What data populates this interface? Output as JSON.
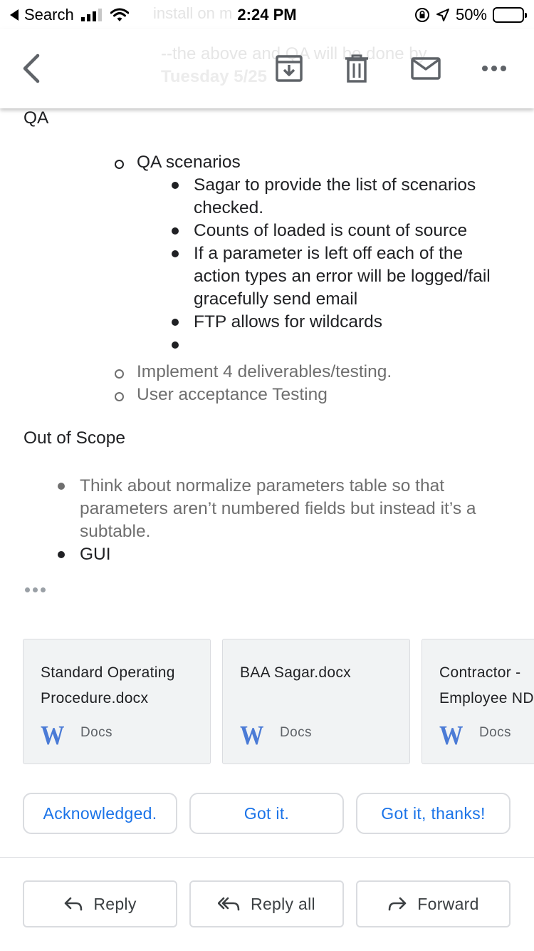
{
  "status_bar": {
    "back_label": "Search",
    "time": "2:24 PM",
    "battery": "50%",
    "battery_level": 0.5,
    "ghost_text": "install on m"
  },
  "toolbar": {
    "back_icon": "back-arrow-icon",
    "ghost_line_1": "--the above and QA will be done by",
    "ghost_line_2": "Tuesday 5/25",
    "actions": [
      {
        "name": "archive-icon"
      },
      {
        "name": "trash-icon"
      },
      {
        "name": "mail-icon"
      },
      {
        "name": "more-options-icon"
      }
    ]
  },
  "body": {
    "qa_heading": "QA",
    "qa_items": [
      "QA scenarios",
      "Implement 4 deliverables/testing.",
      "User acceptance Testing"
    ],
    "qa_scenarios": [
      "Sagar to provide the list of scenarios checked.",
      "Counts of loaded is count of source",
      "If a parameter is left off each of the action types an error will be logged/fail gracefully send email",
      "FTP allows for wildcards",
      ""
    ],
    "out_of_scope_heading": "Out of Scope",
    "out_of_scope_items": [
      "Think about normalize parameters table so that parameters aren’t numbered fields but instead it’s a subtable.",
      "GUI"
    ]
  },
  "attachments": [
    {
      "name": "Standard Operating\nProcedure.docx",
      "icon_letter": "W",
      "kind": "Docs"
    },
    {
      "name": "BAA Sagar.docx",
      "icon_letter": "W",
      "kind": "Docs"
    },
    {
      "name": "Contractor -\nEmployee NDA.docx",
      "icon_letter": "W",
      "kind": "Docs"
    }
  ],
  "smart_replies": [
    "Acknowledged.",
    "Got it.",
    "Got it, thanks!"
  ],
  "actions": {
    "reply": "Reply",
    "reply_all": "Reply all",
    "forward": "Forward"
  },
  "colors": {
    "link_blue": "#1a73e8",
    "word_blue": "#4b7bd6",
    "chip_border": "#dadce0",
    "attachment_bg": "#f1f3f4"
  }
}
